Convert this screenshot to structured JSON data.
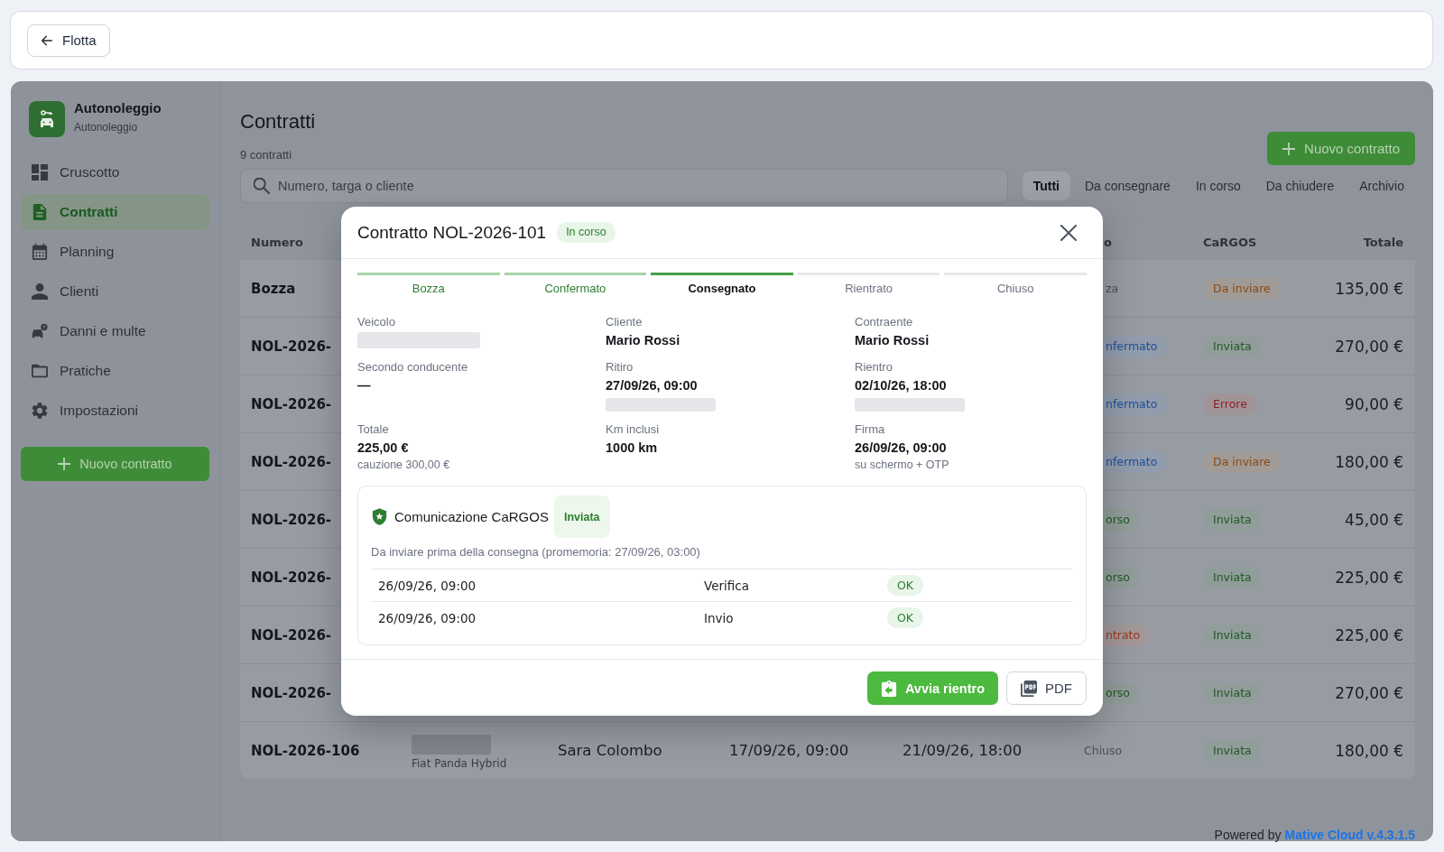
{
  "topbar": {
    "back_button": "Flotta"
  },
  "sidebar": {
    "app_name": "Autonoleggio",
    "app_subtitle": "Autonoleggio",
    "items": [
      {
        "label": "Cruscotto",
        "selected": false
      },
      {
        "label": "Contratti",
        "selected": true
      },
      {
        "label": "Planning",
        "selected": false
      },
      {
        "label": "Clienti",
        "selected": false
      },
      {
        "label": "Danni e multe",
        "selected": false
      },
      {
        "label": "Pratiche",
        "selected": false
      },
      {
        "label": "Impostazioni",
        "selected": false
      }
    ],
    "new_button": "Nuovo contratto"
  },
  "page": {
    "title": "Contratti",
    "count": "9 contratti",
    "new_button": "Nuovo contratto",
    "search": {
      "placeholder": "Numero, targa o cliente"
    },
    "filters": [
      {
        "label": "Tutti",
        "selected": true
      },
      {
        "label": "Da consegnare",
        "selected": false
      },
      {
        "label": "In corso",
        "selected": false
      },
      {
        "label": "Da chiudere",
        "selected": false
      },
      {
        "label": "Archivio",
        "selected": false
      }
    ]
  },
  "table": {
    "columns": [
      {
        "label": "Numero"
      },
      {
        "label": "o"
      },
      {
        "label": "CaRGOS"
      },
      {
        "label": "Totale"
      }
    ],
    "rows": [
      {
        "kind": "covered",
        "number": "Bozza",
        "status": {
          "text": "za",
          "color": "#4b5057"
        },
        "cargos": {
          "text": "Da inviare",
          "color": "#8a4a12"
        },
        "total": "135,00 €"
      },
      {
        "kind": "covered",
        "number": "NOL-2026-",
        "status": {
          "text": "nfermato",
          "color": "#1e4f9a"
        },
        "cargos": {
          "text": "Inviata",
          "color": "#1f5a22"
        },
        "total": "270,00 €"
      },
      {
        "kind": "covered",
        "number": "NOL-2026-",
        "status": {
          "text": "nfermato",
          "color": "#1e4f9a"
        },
        "cargos": {
          "text": "Errore",
          "color": "#8b1d1d"
        },
        "total": "90,00 €"
      },
      {
        "kind": "covered",
        "number": "NOL-2026-",
        "status": {
          "text": "nfermato",
          "color": "#1e4f9a"
        },
        "cargos": {
          "text": "Da inviare",
          "color": "#8a4a12"
        },
        "total": "180,00 €"
      },
      {
        "kind": "covered",
        "number": "NOL-2026-",
        "status": {
          "text": "orso",
          "color": "#1f5a22"
        },
        "cargos": {
          "text": "Inviata",
          "color": "#1f5a22"
        },
        "total": "45,00 €"
      },
      {
        "kind": "covered",
        "number": "NOL-2026-",
        "status": {
          "text": "orso",
          "color": "#1f5a22"
        },
        "cargos": {
          "text": "Inviata",
          "color": "#1f5a22"
        },
        "total": "225,00 €"
      },
      {
        "kind": "covered",
        "number": "NOL-2026-",
        "status": {
          "text": "ntrato",
          "color": "#9a3a1c"
        },
        "cargos": {
          "text": "Inviata",
          "color": "#1f5a22"
        },
        "total": "225,00 €"
      },
      {
        "kind": "covered",
        "number": "NOL-2026-",
        "status": {
          "text": "orso",
          "color": "#1f5a22"
        },
        "cargos": {
          "text": "Inviata",
          "color": "#1f5a22"
        },
        "total": "270,00 €"
      },
      {
        "kind": "full",
        "number": "NOL-2026-106",
        "vehicle": {
          "model": "Fiat Panda Hybrid"
        },
        "client": "Sara Colombo",
        "pickup": "17/09/26, 09:00",
        "return": "21/09/26, 18:00",
        "status": {
          "text": "Chiuso",
          "color": "#4b5057"
        },
        "cargos": {
          "text": "Inviata",
          "color": "#1f5a22"
        },
        "total": "180,00 €"
      }
    ]
  },
  "footer": {
    "label": "Powered by",
    "link": "Mative Cloud v.4.3.1.5"
  },
  "modal": {
    "title": "Contratto NOL-2026-101",
    "status": "In corso",
    "steps": [
      {
        "label": "Bozza",
        "completed": true,
        "selected": false
      },
      {
        "label": "Confermato",
        "completed": true,
        "selected": false
      },
      {
        "label": "Consegnato",
        "completed": false,
        "selected": true
      },
      {
        "label": "Rientrato",
        "completed": false,
        "selected": false
      },
      {
        "label": "Chiuso",
        "completed": false,
        "selected": false
      }
    ],
    "fields": [
      {
        "label": "Veicolo",
        "lines": [
          {
            "kind": "blurred"
          }
        ]
      },
      {
        "label": "Cliente",
        "lines": [
          {
            "kind": "value",
            "text": "Mario Rossi"
          }
        ]
      },
      {
        "label": "Contraente",
        "lines": [
          {
            "kind": "value",
            "text": "Mario Rossi"
          }
        ]
      },
      {
        "label": "Secondo conducente",
        "lines": [
          {
            "kind": "value",
            "text": "—"
          }
        ]
      },
      {
        "label": "Ritiro",
        "lines": [
          {
            "kind": "value",
            "text": "27/09/26, 09:00"
          },
          {
            "kind": "blurred"
          }
        ]
      },
      {
        "label": "Rientro",
        "lines": [
          {
            "kind": "value",
            "text": "02/10/26, 18:00"
          },
          {
            "kind": "blurred"
          }
        ]
      },
      {
        "label": "Totale",
        "lines": [
          {
            "kind": "value",
            "text": "225,00 €"
          },
          {
            "kind": "note",
            "text": "cauzione 300,00 €"
          }
        ]
      },
      {
        "label": "Km inclusi",
        "lines": [
          {
            "kind": "value",
            "text": "1000 km"
          }
        ]
      },
      {
        "label": "Firma",
        "lines": [
          {
            "kind": "value",
            "text": "26/09/26, 09:00"
          },
          {
            "kind": "note",
            "text": "su schermo + OTP"
          }
        ]
      }
    ],
    "cargos": {
      "title": "Comunicazione CaRGOS",
      "status": "Inviata",
      "note": "Da inviare prima della consegna (promemoria: 27/09/26, 03:00)",
      "log": [
        {
          "time": "26/09/26, 09:00",
          "action": "Verifica",
          "result": "OK"
        },
        {
          "time": "26/09/26, 09:00",
          "action": "Invio",
          "result": "OK"
        }
      ]
    },
    "actions": [
      {
        "label": "Avvia rientro",
        "kind": "primary"
      },
      {
        "label": "PDF",
        "kind": "secondary"
      }
    ]
  }
}
